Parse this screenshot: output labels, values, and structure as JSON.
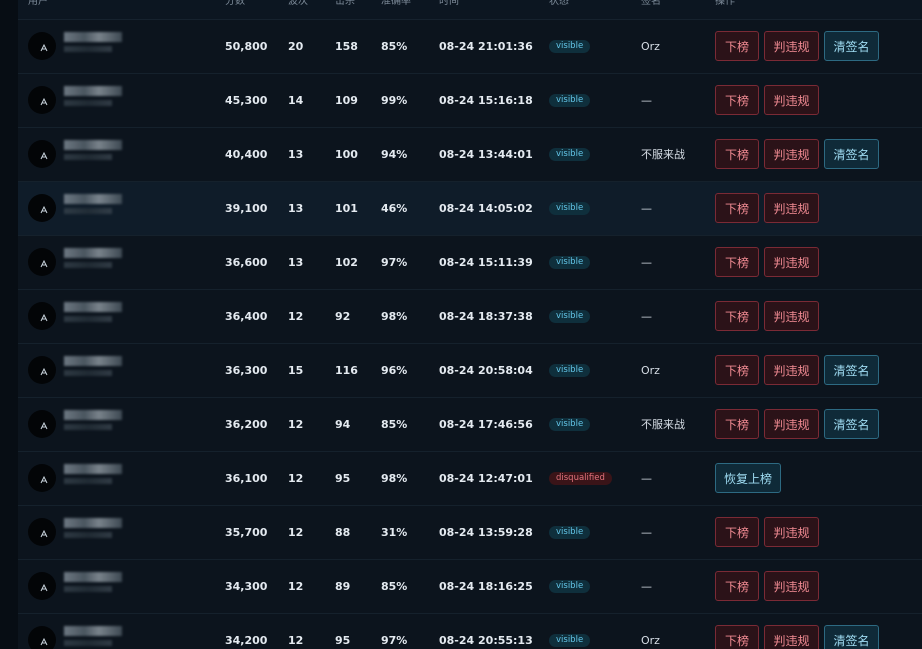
{
  "header": {
    "user": "用户",
    "score": "分数",
    "waves": "波次",
    "kills": "击杀",
    "accuracy": "准确率",
    "time": "时间",
    "status": "状态",
    "signature": "签名",
    "actions": "操作"
  },
  "buttons": {
    "delist": "下榜",
    "violation": "判违规",
    "clear_signature": "清签名",
    "restore": "恢复上榜"
  },
  "rows": [
    {
      "score": "50,800",
      "waves": "20",
      "kills": "158",
      "accuracy": "85%",
      "time": "08-24 21:01:36",
      "status": "visible",
      "signature": "Orz"
    },
    {
      "score": "45,300",
      "waves": "14",
      "kills": "109",
      "accuracy": "99%",
      "time": "08-24 15:16:18",
      "status": "visible",
      "signature": "—"
    },
    {
      "score": "40,400",
      "waves": "13",
      "kills": "100",
      "accuracy": "94%",
      "time": "08-24 13:44:01",
      "status": "visible",
      "signature": "不服来战"
    },
    {
      "score": "39,100",
      "waves": "13",
      "kills": "101",
      "accuracy": "46%",
      "time": "08-24 14:05:02",
      "status": "visible",
      "signature": "—"
    },
    {
      "score": "36,600",
      "waves": "13",
      "kills": "102",
      "accuracy": "97%",
      "time": "08-24 15:11:39",
      "status": "visible",
      "signature": "—"
    },
    {
      "score": "36,400",
      "waves": "12",
      "kills": "92",
      "accuracy": "98%",
      "time": "08-24 18:37:38",
      "status": "visible",
      "signature": "—"
    },
    {
      "score": "36,300",
      "waves": "15",
      "kills": "116",
      "accuracy": "96%",
      "time": "08-24 20:58:04",
      "status": "visible",
      "signature": "Orz"
    },
    {
      "score": "36,200",
      "waves": "12",
      "kills": "94",
      "accuracy": "85%",
      "time": "08-24 17:46:56",
      "status": "visible",
      "signature": "不服来战"
    },
    {
      "score": "36,100",
      "waves": "12",
      "kills": "95",
      "accuracy": "98%",
      "time": "08-24 12:47:01",
      "status": "disqualified",
      "signature": "—"
    },
    {
      "score": "35,700",
      "waves": "12",
      "kills": "88",
      "accuracy": "31%",
      "time": "08-24 13:59:28",
      "status": "visible",
      "signature": "—"
    },
    {
      "score": "34,300",
      "waves": "12",
      "kills": "89",
      "accuracy": "85%",
      "time": "08-24 18:16:25",
      "status": "visible",
      "signature": "—"
    },
    {
      "score": "34,200",
      "waves": "12",
      "kills": "95",
      "accuracy": "97%",
      "time": "08-24 20:55:13",
      "status": "visible",
      "signature": "Orz"
    }
  ],
  "colors": {
    "background": "#0b131c",
    "row_highlight": "#0f1c29",
    "danger_button": "#f08a92",
    "info_button": "#9fdcf2",
    "visible_badge": "#63c6e8",
    "disqualified_badge": "#e2727c"
  }
}
